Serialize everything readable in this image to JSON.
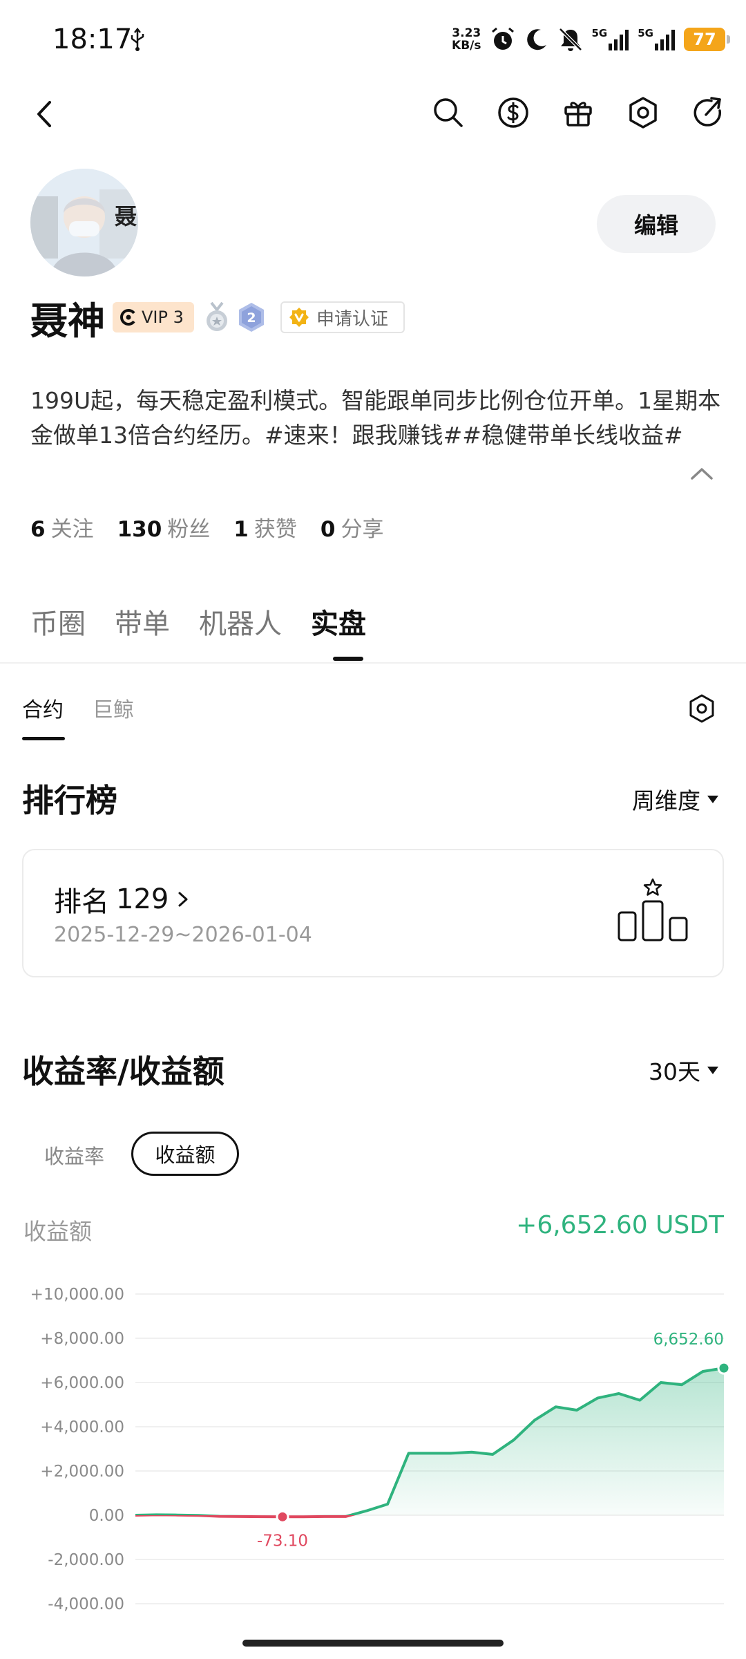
{
  "status_bar": {
    "time": "18:17",
    "net_speed_value": "3.23",
    "net_speed_unit": "KB/s",
    "signal_1": "5G",
    "signal_2": "5G",
    "battery": "77",
    "icons": [
      "usb-icon",
      "alarm-icon",
      "moon-icon",
      "mute-icon",
      "signal-icon",
      "battery-icon"
    ]
  },
  "nav": {
    "icons": [
      "back-icon",
      "search-icon",
      "dollar-icon",
      "gift-icon",
      "settings-icon",
      "share-icon"
    ]
  },
  "profile": {
    "avatar_name": "聂",
    "edit_label": "编辑",
    "username": "聂神",
    "vip_label": "VIP 3",
    "level": "2",
    "verify_label": "申请认证",
    "bio": "199U起，每天稳定盈利模式。智能跟单同步比例仓位开单。1星期本金做单13倍合约经历。#速来！跟我赚钱##稳健带单长线收益#",
    "stats": [
      {
        "value": "6",
        "label": "关注"
      },
      {
        "value": "130",
        "label": "粉丝"
      },
      {
        "value": "1",
        "label": "获赞"
      },
      {
        "value": "0",
        "label": "分享"
      }
    ]
  },
  "main_tabs": [
    "币圈",
    "带单",
    "机器人",
    "实盘"
  ],
  "active_main_tab": "实盘",
  "sub_tabs": [
    "合约",
    "巨鲸"
  ],
  "active_sub_tab": "合约",
  "leaderboard": {
    "title": "排行榜",
    "period": "周维度",
    "rank_label": "排名",
    "rank_value": "129",
    "date_range": "2025-12-29~2026-01-04"
  },
  "pnl": {
    "title": "收益率/收益额",
    "days": "30天",
    "toggle_rate": "收益率",
    "toggle_amount": "收益额",
    "metric_label": "收益额",
    "metric_value": "+6,652.60 USDT",
    "colors": {
      "positive": "#2fb37e",
      "negative": "#e0485f"
    }
  },
  "chart_data": {
    "type": "line",
    "y_ticks": [
      "+10,000.00",
      "+8,000.00",
      "+6,000.00",
      "+4,000.00",
      "+2,000.00",
      "0.00",
      "-2,000.00",
      "-4,000.00"
    ],
    "ylim": [
      -4000,
      10000
    ],
    "values": [
      0,
      20,
      10,
      -10,
      -50,
      -60,
      -65,
      -73.1,
      -70,
      -60,
      -60,
      200,
      500,
      2800,
      2800,
      2800,
      2850,
      2750,
      3400,
      4300,
      4900,
      4750,
      5300,
      5500,
      5200,
      6000,
      5900,
      6500,
      6652.6
    ],
    "min_label": "-73.10",
    "max_label": "6,652.60",
    "min_index": 7,
    "max_index": 28
  }
}
